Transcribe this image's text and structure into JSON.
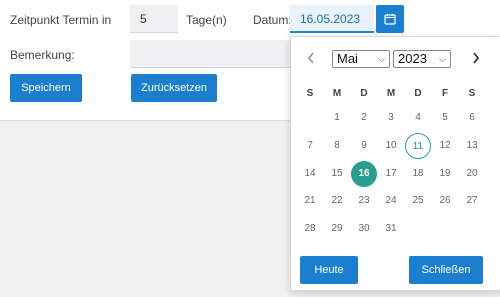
{
  "form": {
    "termin_label": "Zeitpunkt Termin in",
    "termin_value": "5",
    "unit_label": "Tage(n)",
    "date_label": "Datum:",
    "date_value": "16.05.2023",
    "remark_label": "Bemerkung:",
    "remark_value": "",
    "save_label": "Speichern",
    "reset_label": "Zurücksetzen"
  },
  "datepicker": {
    "month": "Mai",
    "year": "2023",
    "weekdays": [
      "S",
      "M",
      "D",
      "M",
      "D",
      "F",
      "S"
    ],
    "weeks": [
      [
        "",
        "1",
        "2",
        "3",
        "4",
        "5",
        "6"
      ],
      [
        "7",
        "8",
        "9",
        "10",
        "11",
        "12",
        "13"
      ],
      [
        "14",
        "15",
        "16",
        "17",
        "18",
        "19",
        "20"
      ],
      [
        "21",
        "22",
        "23",
        "24",
        "25",
        "26",
        "27"
      ],
      [
        "28",
        "29",
        "30",
        "31",
        "",
        "",
        ""
      ]
    ],
    "today_day": "11",
    "selected_day": "16",
    "today_button": "Heute",
    "close_button": "Schließen"
  },
  "colors": {
    "primary": "#1b7fd0",
    "selected_day": "#2a9d8f",
    "today_ring": "#2aa198"
  },
  "icons": {
    "calendar": "calendar-icon",
    "prev": "chevron-left-icon",
    "next": "chevron-right-icon"
  }
}
